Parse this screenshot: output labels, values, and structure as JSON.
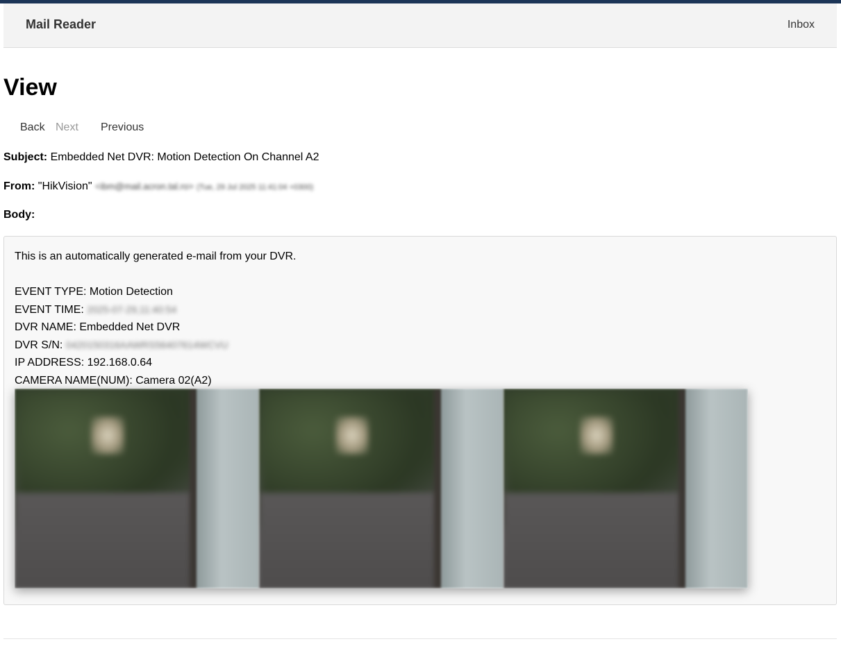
{
  "navbar": {
    "brand": "Mail Reader",
    "inbox_link": "Inbox"
  },
  "page": {
    "title": "View"
  },
  "pager": {
    "back": "Back",
    "next": "Next",
    "previous": "Previous"
  },
  "message": {
    "subject_label": "Subject:",
    "subject": "Embedded Net DVR: Motion Detection On Channel A2",
    "from_label": "From:",
    "from_name": "\"HikVision\"",
    "from_address": "<ibm@mail.acron.tal.ro>",
    "from_date": "(Tue, 29 Jul 2025 11:41:04 +0300)",
    "body_label": "Body:",
    "body": {
      "intro": "This is an automatically generated e-mail from your DVR.",
      "event_type": "EVENT TYPE: Motion Detection",
      "event_time_label": "EVENT TIME: ",
      "event_time_value": "2025-07-29,11:40:54",
      "dvr_name": "DVR NAME: Embedded Net DVR",
      "dvr_sn_label": "DVR S/N: ",
      "dvr_sn_value": "0420150316AAWRS56407614WCVU",
      "ip_address": "IP ADDRESS: 192.168.0.64",
      "camera_name": "CAMERA NAME(NUM): Camera 02(A2)"
    },
    "snapshot_count": 3
  }
}
